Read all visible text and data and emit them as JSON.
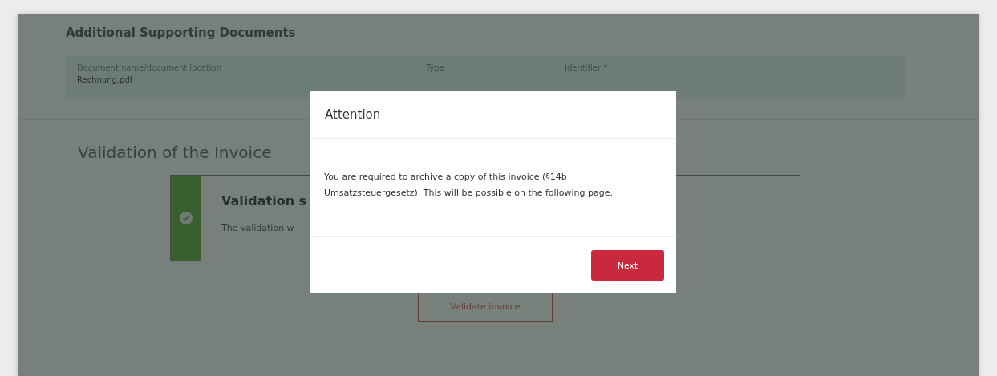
{
  "documents": {
    "title": "Additional Supporting Documents",
    "columns": [
      "Document name/document location",
      "Type",
      "Identifier *"
    ],
    "rows": [
      {
        "name": "Rechnung.pdf"
      }
    ]
  },
  "validation": {
    "title": "Validation of the Invoice",
    "result": {
      "success": true,
      "title": "Validation s",
      "message": "The validation w"
    },
    "button": "Validate invoice"
  },
  "modal": {
    "title": "Attention",
    "body": "You are required to archive a copy of this invoice (§14b Umsatzsteuergesetz). This will be possible on the following page.",
    "button": "Next"
  }
}
